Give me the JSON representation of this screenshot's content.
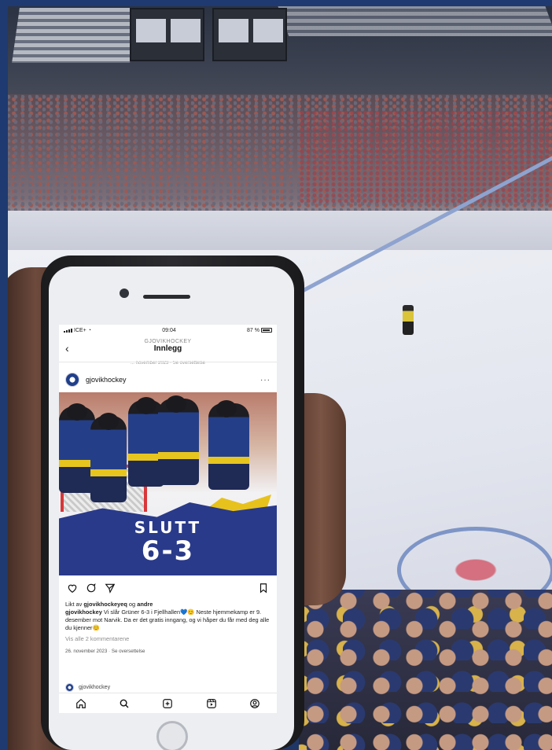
{
  "status_bar": {
    "carrier": "ICE+",
    "time": "09:04",
    "battery": "87 %",
    "battery_level": 0.87
  },
  "header": {
    "account": "GJOVIKHOCKEY",
    "title": "Innlegg",
    "previous_line": "... november 2023 · Se oversettelse"
  },
  "post": {
    "username": "gjovikhockey",
    "more_icon": "more-dots-icon",
    "image": {
      "headline": "SLUTT",
      "score": "6-3"
    },
    "liked_by_prefix": "Likt av ",
    "liked_by_user": "gjovikhockeyeq",
    "liked_by_suffix": " og ",
    "liked_by_others": "andre",
    "caption_user": "gjovikhockey",
    "caption_text": " Vi slår Grüner 6-3 i Fjellhallen💙😊 Neste hjemmekamp er 9. desember mot Narvik. Da er det gratis inngang, og vi håper du får med deg alle du kjenner😊",
    "view_comments": "Vis alle 2 kommentarene",
    "date": "26. november 2023",
    "translate": "Se oversettelse"
  },
  "next_post": {
    "username": "gjovikhockey"
  },
  "icons": {
    "back": "back-arrow-icon",
    "like": "heart-icon",
    "comment": "comment-icon",
    "share": "send-icon",
    "save": "bookmark-icon",
    "home": "home-icon",
    "search": "search-icon",
    "create": "plus-square-icon",
    "reels": "reels-icon",
    "profile": "profile-icon"
  },
  "colors": {
    "team_blue": "#2a3a8a",
    "team_yellow": "#e8c21c",
    "instagram_text": "#111111"
  }
}
